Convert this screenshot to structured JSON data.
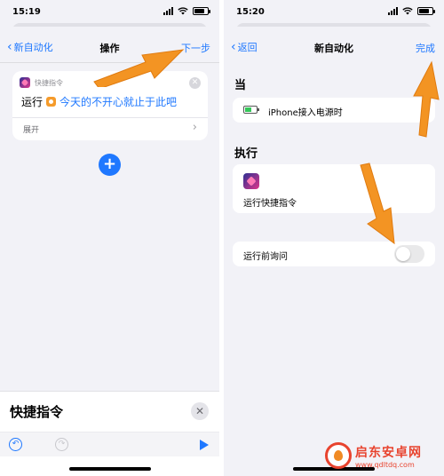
{
  "left_screen": {
    "status": {
      "time": "15:19"
    },
    "nav": {
      "back_label": "新自动化",
      "title": "操作",
      "action_label": "下一步"
    },
    "action_card": {
      "app_name": "快捷指令",
      "run_label": "运行",
      "shortcut_name": "今天的不开心就止于此吧",
      "expand_label": "展开"
    },
    "bottom_sheet": {
      "title": "快捷指令"
    }
  },
  "right_screen": {
    "status": {
      "time": "15:20"
    },
    "nav": {
      "back_label": "返回",
      "title": "新自动化",
      "action_label": "完成"
    },
    "when_label": "当",
    "trigger_text": "iPhone接入电源时",
    "execute_label": "执行",
    "execute_action": "运行快捷指令",
    "ask_label": "运行前询问",
    "ask_enabled": false
  },
  "watermark": {
    "name": "启东安卓网",
    "url": "www.qdltdq.com"
  },
  "colors": {
    "accent": "#1f78ff",
    "arrow": "#f39423",
    "watermark": "#e8432e"
  },
  "icons": [
    "shortcuts-app-icon",
    "close-icon",
    "plus-icon",
    "undo-icon",
    "redo-icon",
    "play-icon",
    "battery-charging-icon",
    "chevron-left-icon",
    "chevron-right-icon"
  ]
}
